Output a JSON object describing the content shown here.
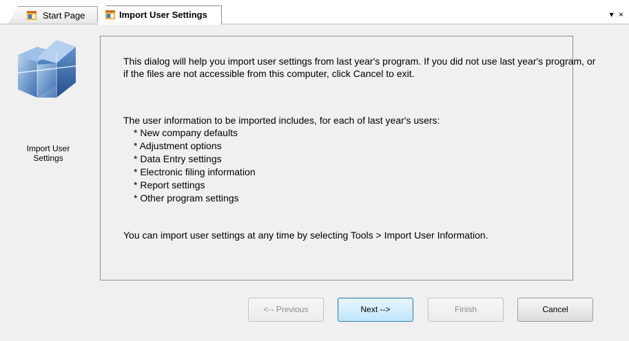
{
  "tabs": {
    "start_page": "Start Page",
    "import_user_settings": "Import User Settings",
    "menu_glyphs": "▾ ×"
  },
  "sidebar": {
    "label": "Import User Settings"
  },
  "content": {
    "intro": "This dialog will help you import user settings from last year's program. If you did not use last year's program, or if the files are not accessible from this computer, click Cancel to exit.",
    "list_title": "The user information to be imported includes, for each of last year's users:",
    "items": [
      "* New company defaults",
      "* Adjustment options",
      "* Data Entry settings",
      "* Electronic filing information",
      "* Report settings",
      "* Other program settings"
    ],
    "outro": "You can import user settings at any time by selecting Tools > Import User Information."
  },
  "buttons": {
    "previous": "<-- Previous",
    "next": "Next -->",
    "finish": "Finish",
    "cancel": "Cancel"
  },
  "colors": {
    "tab_icon_orange": "#f0a030",
    "cube_blue": "#4a7fc0",
    "next_border": "#3c7fb1"
  }
}
